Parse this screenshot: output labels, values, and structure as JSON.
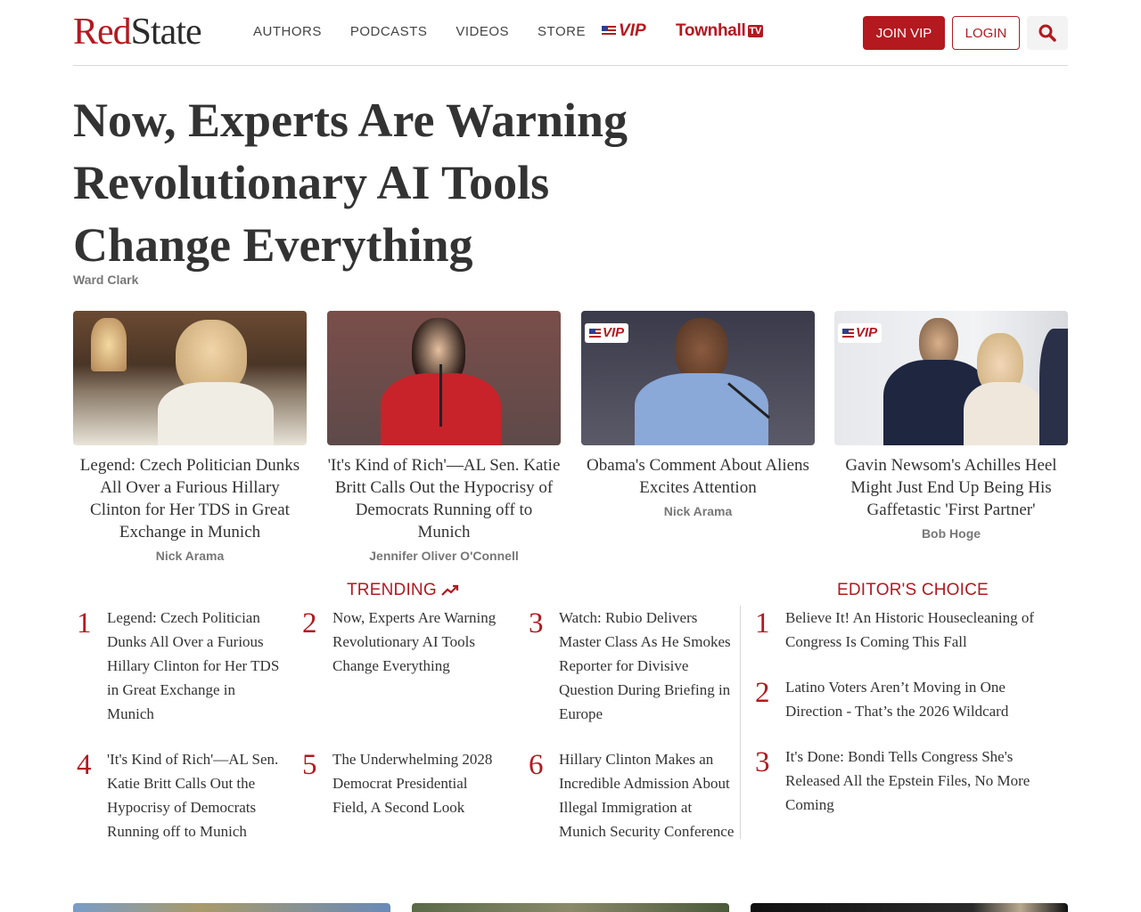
{
  "header": {
    "logo_red": "Red",
    "logo_dark": "State",
    "nav": [
      "AUTHORS",
      "PODCASTS",
      "VIDEOS",
      "STORE"
    ],
    "vip_label": "VIP",
    "townhall_label": "Townhall",
    "townhall_tv": "TV",
    "join_label": "JOIN VIP",
    "login_label": "LOGIN"
  },
  "main": {
    "headline": "Now, Experts Are Warning Revolutionary AI Tools Change Everything",
    "byline": "Ward Clark"
  },
  "cards": [
    {
      "title": "Legend: Czech Politician Dunks All Over a Furious Hillary Clinton for Her TDS in Great Exchange in Munich",
      "author": "Nick Arama",
      "vip": false
    },
    {
      "title": "'It's Kind of Rich'—AL Sen. Katie Britt Calls Out the Hypocrisy of Democrats Running off to Munich",
      "author": "Jennifer Oliver O'Connell",
      "vip": false
    },
    {
      "title": "Obama's Comment About Aliens Excites Attention",
      "author": "Nick Arama",
      "vip": true,
      "vip_label": "VIP"
    },
    {
      "title": "Gavin Newsom's Achilles Heel Might Just End Up Being His Gaffetastic 'First Partner'",
      "author": "Bob Hoge",
      "vip": true,
      "vip_label": "VIP"
    }
  ],
  "trending": {
    "title": "TRENDING",
    "items": [
      {
        "rank": "1",
        "text": "Legend: Czech Politician Dunks All Over a Furious Hillary Clinton for Her TDS in Great Exchange in Munich"
      },
      {
        "rank": "2",
        "text": "Now, Experts Are Warning Revolutionary AI Tools Change Everything"
      },
      {
        "rank": "3",
        "text": "Watch: Rubio Delivers Master Class As He Smokes Reporter for Divisive Question During Briefing in Europe"
      },
      {
        "rank": "4",
        "text": "'It's Kind of Rich'—AL Sen. Katie Britt Calls Out the Hypocrisy of Democrats Running off to Munich"
      },
      {
        "rank": "5",
        "text": "The Underwhelming 2028 Democrat Presidential Field, A Second Look"
      },
      {
        "rank": "6",
        "text": "Hillary Clinton Makes an Incredible Admission About Illegal Immigration at Munich Security Conference"
      }
    ]
  },
  "editors_choice": {
    "title": "EDITOR'S CHOICE",
    "items": [
      {
        "rank": "1",
        "text": "Believe It! An Historic Housecleaning of Congress Is Coming This Fall"
      },
      {
        "rank": "2",
        "text": "Latino Voters Aren’t Moving in One Direction - That’s the 2026 Wildcard"
      },
      {
        "rank": "3",
        "text": "It's Done: Bondi Tells Congress She's Released All the Epstein Files, No More Coming"
      }
    ]
  },
  "colors": {
    "brand_red": "#b3191f",
    "text_dark": "#333333",
    "muted": "#777777"
  },
  "icons": [
    "search-icon",
    "trending-arrow-icon",
    "flag-icon"
  ]
}
